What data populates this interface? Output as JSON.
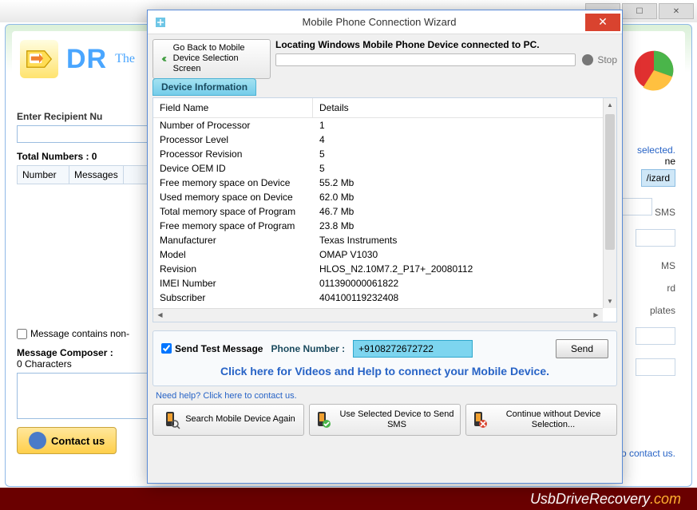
{
  "bg": {
    "brand_prefix": "DR",
    "subtitle": "The",
    "recipient_label": "Enter Recipient Nu",
    "total_label": "Total Numbers : 0",
    "col_number": "Number",
    "col_message": "Messages",
    "nonenglish": "Message contains non-",
    "composer_label": "Message Composer :",
    "composer_count": "0 Characters",
    "contact": "Contact us",
    "right_selected": "selected.",
    "right_ne": "ne",
    "right_wizard": "/izard",
    "right_sms": "SMS",
    "right_ms": "MS",
    "right_rd": "rd",
    "right_plates": "plates",
    "need_help": "Need help? Click here to contact us."
  },
  "url": {
    "main": "UsbDriveRecovery",
    "com": ".com"
  },
  "dialog": {
    "title": "Mobile Phone Connection Wizard",
    "back_button": "Go Back to Mobile Device Selection Screen",
    "locating": "Locating Windows Mobile Phone Device connected to PC.",
    "stop": "Stop",
    "tab": "Device Information",
    "col_field": "Field Name",
    "col_details": "Details",
    "rows": [
      {
        "f": "Number of Processor",
        "d": "1"
      },
      {
        "f": "Processor Level",
        "d": "4"
      },
      {
        "f": "Processor Revision",
        "d": "5"
      },
      {
        "f": "Device OEM ID",
        "d": "5"
      },
      {
        "f": "Free memory space on Device",
        "d": "55.2 Mb"
      },
      {
        "f": "Used memory space on Device",
        "d": "62.0 Mb"
      },
      {
        "f": "Total memory space of Program",
        "d": "46.7 Mb"
      },
      {
        "f": "Free memory space of Program",
        "d": "23.8 Mb"
      },
      {
        "f": "Manufacturer",
        "d": "Texas Instruments"
      },
      {
        "f": "Model",
        "d": "OMAP V1030"
      },
      {
        "f": "Revision",
        "d": "HLOS_N2.10M7.2_P17+_20080112"
      },
      {
        "f": "IMEI Number",
        "d": "011390000061822"
      },
      {
        "f": "Subscriber",
        "d": "404100119232408"
      }
    ],
    "send_test": "Send Test Message",
    "phone_label": "Phone Number :",
    "phone_value": "+9108272672722",
    "send": "Send",
    "videos": "Click here for Videos and Help to connect your Mobile Device.",
    "need": "Need help? Click here to contact us.",
    "btn_search": "Search Mobile Device Again",
    "btn_use": "Use Selected Device to Send SMS",
    "btn_continue": "Continue without Device Selection..."
  }
}
